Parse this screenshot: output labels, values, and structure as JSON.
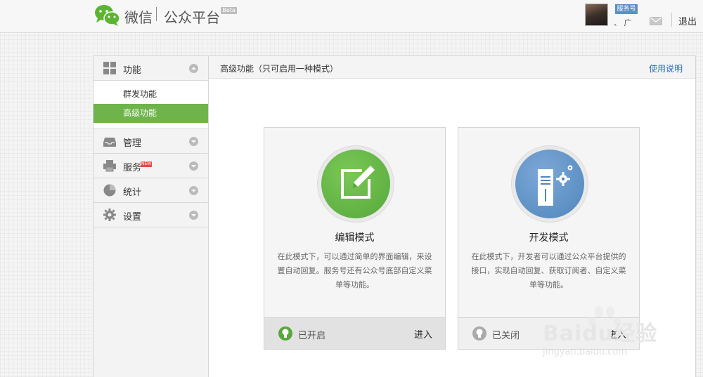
{
  "header": {
    "brand_name": "微信",
    "brand_platform": "公众平台",
    "beta_label": "Beta",
    "account_badge": "服务号",
    "account_name": "、 广",
    "logout_label": "退出"
  },
  "sidebar": {
    "groups": [
      {
        "label": "功能",
        "icon": "grid-icon",
        "expanded": true
      },
      {
        "label": "管理",
        "icon": "inbox-icon",
        "expanded": false
      },
      {
        "label": "服务",
        "icon": "printer-icon",
        "expanded": false,
        "badge": "NEW"
      },
      {
        "label": "统计",
        "icon": "pie-chart-icon",
        "expanded": false
      },
      {
        "label": "设置",
        "icon": "gear-icon",
        "expanded": false
      }
    ],
    "sub_items": [
      {
        "label": "群发功能",
        "active": false
      },
      {
        "label": "高级功能",
        "active": true
      }
    ]
  },
  "main": {
    "title": "高级功能（只可启用一种模式）",
    "help_label": "使用说明",
    "cards": [
      {
        "title": "编辑模式",
        "description": "在此模式下，可以通过简单的界面编辑，来设置自动回复。服务号还有公众号底部自定义菜单等功能。",
        "status": "已开启",
        "enter_label": "进入",
        "icon": "edit-icon"
      },
      {
        "title": "开发模式",
        "description": "在此模式下，开发者可以通过公众平台提供的接口，实现自动回复、获取订阅者、自定义菜单等功能。",
        "status": "已关闭",
        "enter_label": "进入",
        "icon": "server-gear-icon"
      }
    ]
  },
  "watermark": {
    "text": "Baidu经验",
    "sub": "jingyan.baidu.com"
  },
  "colors": {
    "accent_green": "#6fb44b",
    "dev_blue": "#5b8fc7",
    "link_blue": "#2a6fb4"
  }
}
